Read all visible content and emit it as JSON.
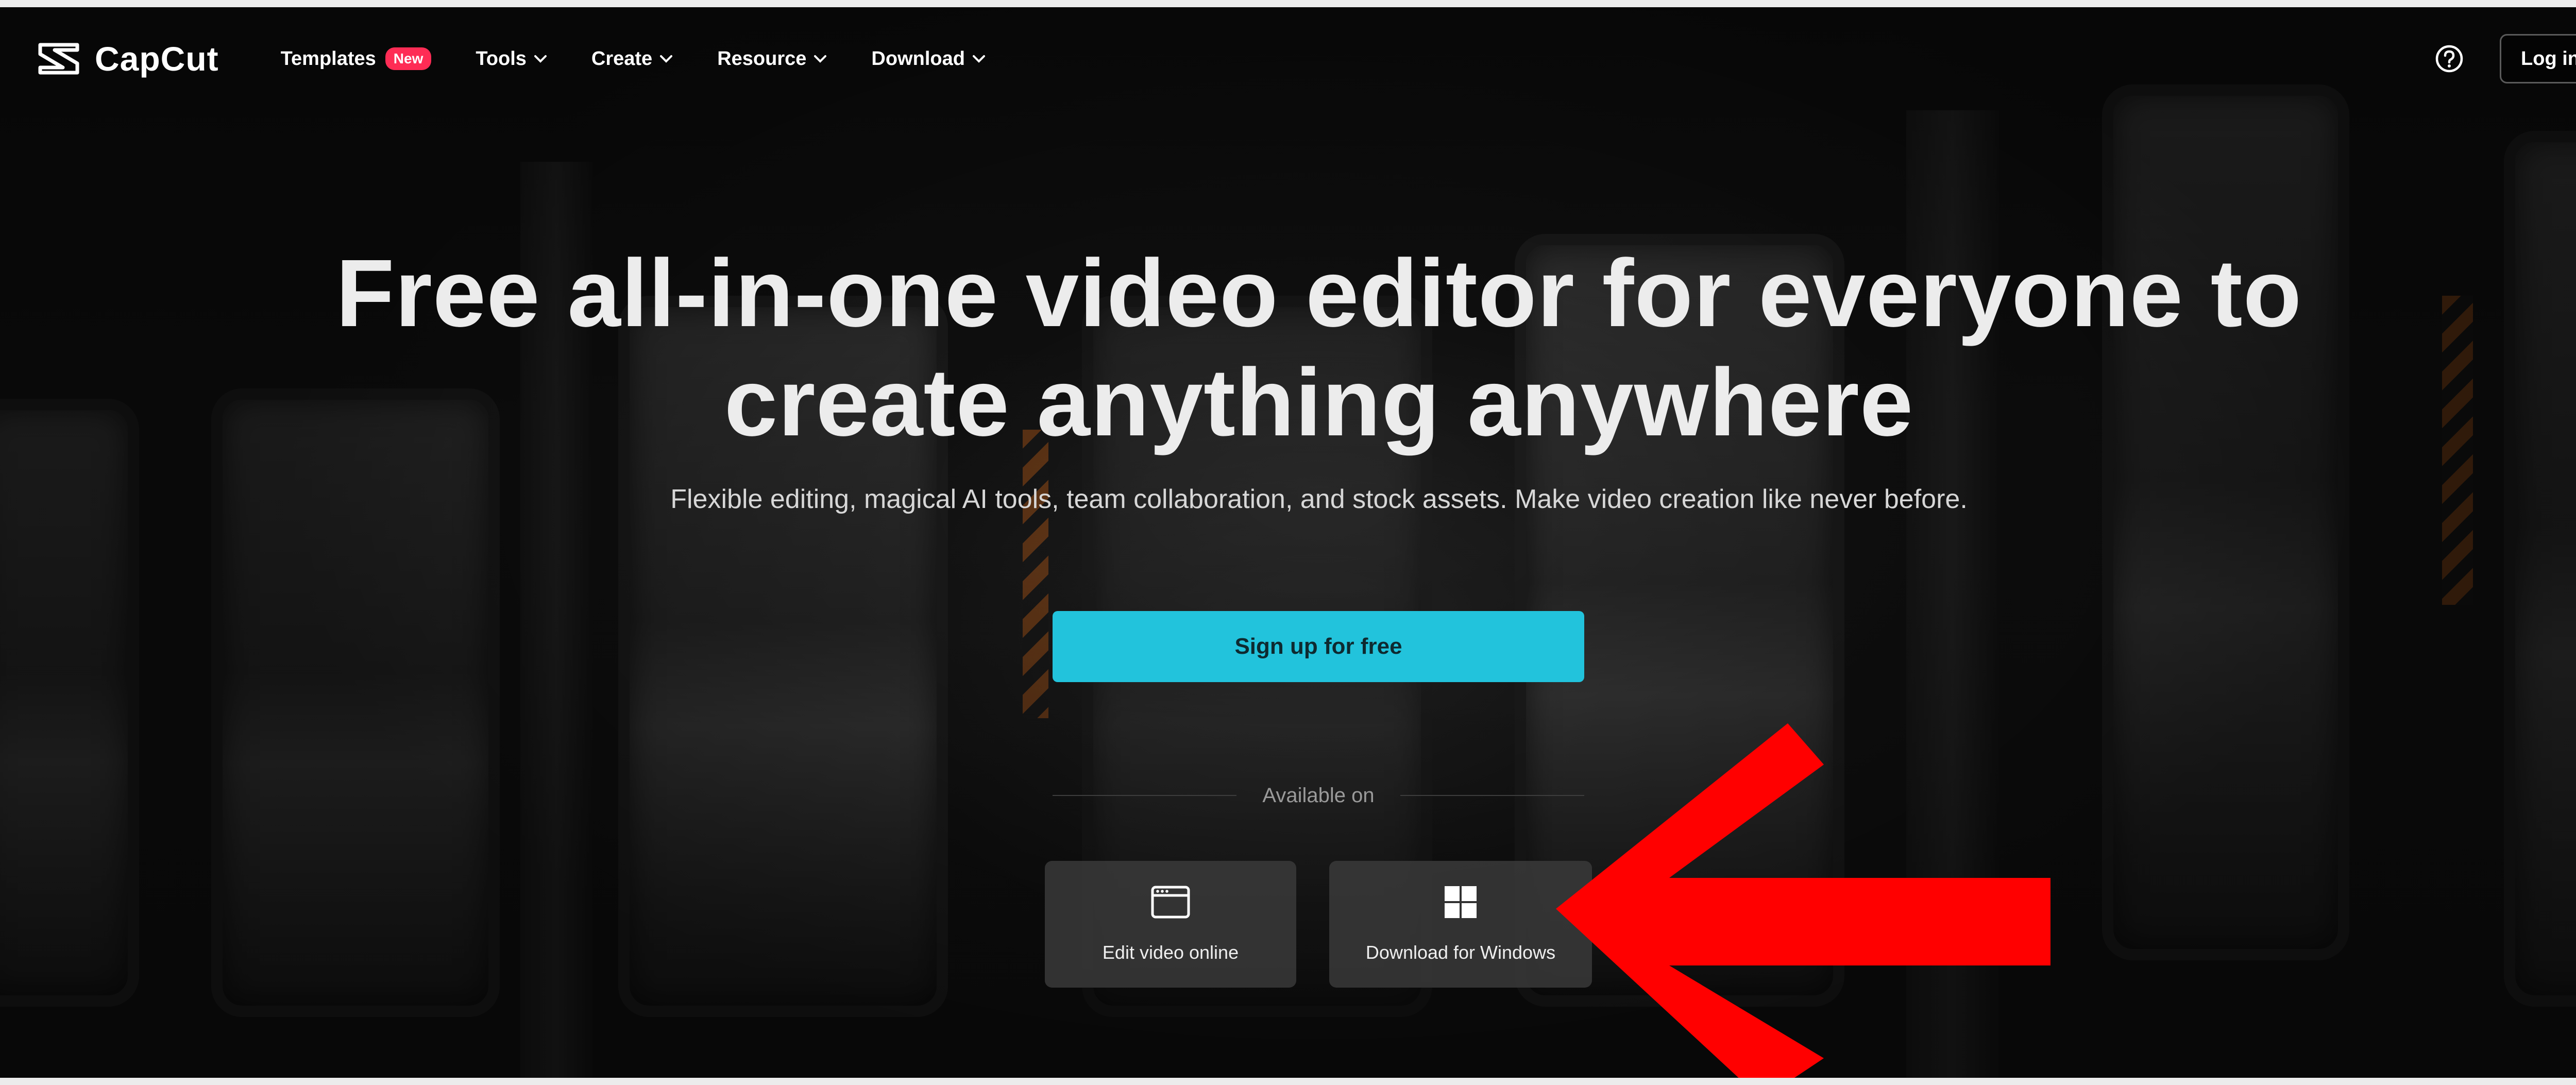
{
  "brand": {
    "name": "CapCut"
  },
  "nav": {
    "items": [
      {
        "label": "Templates",
        "badge": "New",
        "has_dropdown": false
      },
      {
        "label": "Tools",
        "has_dropdown": true
      },
      {
        "label": "Create",
        "has_dropdown": true
      },
      {
        "label": "Resource",
        "has_dropdown": true
      },
      {
        "label": "Download",
        "has_dropdown": true
      }
    ],
    "login_label": "Log in",
    "help_icon": "question-circle-icon"
  },
  "hero": {
    "title_line1": "Free all-in-one video editor for everyone to",
    "title_line2": "create anything anywhere",
    "subtitle": "Flexible editing, magical AI tools, team collaboration, and stock assets. Make video creation like never before.",
    "cta_label": "Sign up for free",
    "available_label": "Available on",
    "platforms": [
      {
        "label": "Edit video online",
        "icon": "browser-window-icon"
      },
      {
        "label": "Download for Windows",
        "icon": "windows-logo-icon"
      }
    ]
  },
  "colors": {
    "accent": "#22c3dc",
    "badge": "#fe2c55",
    "annotation": "#ff0000",
    "background": "#121212"
  },
  "annotation": {
    "icon": "red-arrow-left-icon"
  }
}
